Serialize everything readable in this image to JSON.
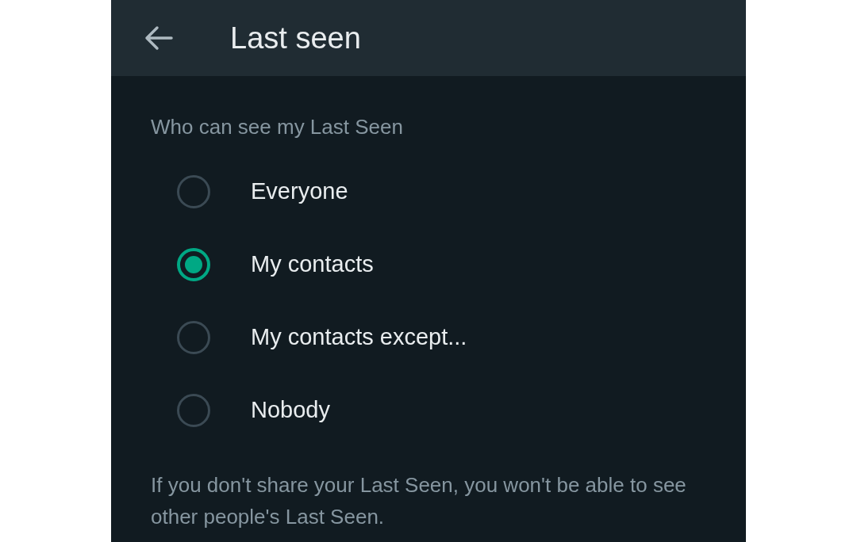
{
  "header": {
    "title": "Last seen"
  },
  "section_title": "Who can see my Last Seen",
  "options": [
    {
      "label": "Everyone",
      "selected": false
    },
    {
      "label": "My contacts",
      "selected": true
    },
    {
      "label": "My contacts except...",
      "selected": false
    },
    {
      "label": "Nobody",
      "selected": false
    }
  ],
  "footnote": "If you don't share your Last Seen, you won't be able to see other people's Last Seen."
}
